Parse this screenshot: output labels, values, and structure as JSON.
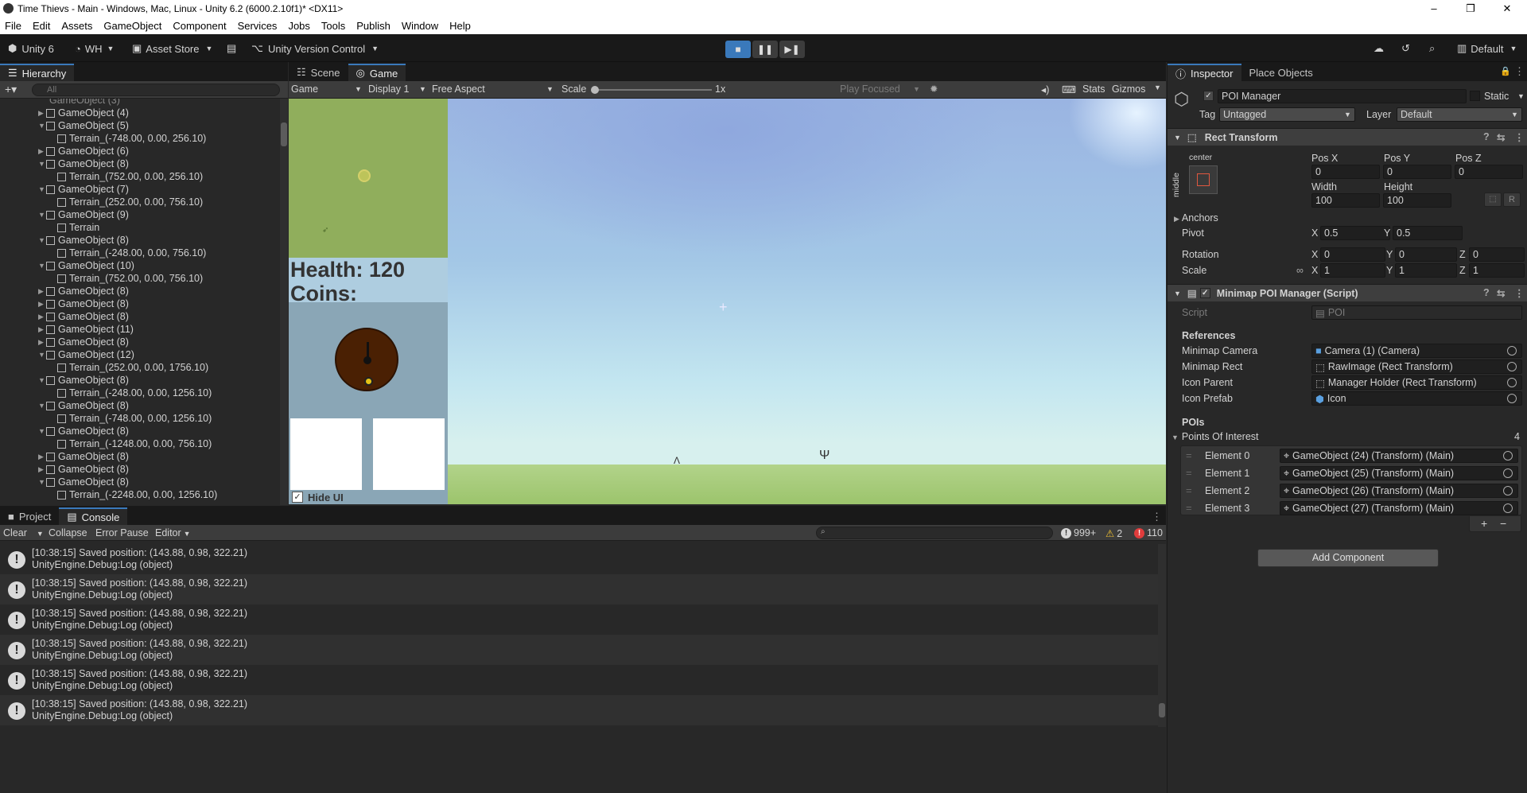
{
  "window": {
    "title": "Time Thievs - Main - Windows, Mac, Linux - Unity 6.2 (6000.2.10f1)* <DX11>"
  },
  "menu": [
    "File",
    "Edit",
    "Assets",
    "GameObject",
    "Component",
    "Services",
    "Jobs",
    "Tools",
    "Publish",
    "Window",
    "Help"
  ],
  "toolbar": {
    "unity": "Unity 6",
    "account": "WH",
    "asset_store": "Asset Store",
    "version_control": "Unity Version Control",
    "layout": "Default"
  },
  "hierarchy": {
    "tab": "Hierarchy",
    "search_placeholder": "All",
    "rows": [
      {
        "label": "GameObject (4)",
        "indent": 1,
        "open": false
      },
      {
        "label": "GameObject (5)",
        "indent": 1,
        "open": true
      },
      {
        "label": "Terrain_(-748.00, 0.00, 256.10)",
        "indent": 2,
        "open": null
      },
      {
        "label": "GameObject (6)",
        "indent": 1,
        "open": false
      },
      {
        "label": "GameObject (8)",
        "indent": 1,
        "open": true
      },
      {
        "label": "Terrain_(752.00, 0.00, 256.10)",
        "indent": 2,
        "open": null
      },
      {
        "label": "GameObject (7)",
        "indent": 1,
        "open": true
      },
      {
        "label": "Terrain_(252.00, 0.00, 756.10)",
        "indent": 2,
        "open": null
      },
      {
        "label": "GameObject (9)",
        "indent": 1,
        "open": true
      },
      {
        "label": "Terrain",
        "indent": 2,
        "open": null
      },
      {
        "label": "GameObject (8)",
        "indent": 1,
        "open": true
      },
      {
        "label": "Terrain_(-248.00, 0.00, 756.10)",
        "indent": 2,
        "open": null
      },
      {
        "label": "GameObject (10)",
        "indent": 1,
        "open": true
      },
      {
        "label": "Terrain_(752.00, 0.00, 756.10)",
        "indent": 2,
        "open": null
      },
      {
        "label": "GameObject (8)",
        "indent": 1,
        "open": false
      },
      {
        "label": "GameObject (8)",
        "indent": 1,
        "open": false
      },
      {
        "label": "GameObject (8)",
        "indent": 1,
        "open": false
      },
      {
        "label": "GameObject (11)",
        "indent": 1,
        "open": false
      },
      {
        "label": "GameObject (8)",
        "indent": 1,
        "open": false
      },
      {
        "label": "GameObject (12)",
        "indent": 1,
        "open": true
      },
      {
        "label": "Terrain_(252.00, 0.00, 1756.10)",
        "indent": 2,
        "open": null
      },
      {
        "label": "GameObject (8)",
        "indent": 1,
        "open": true
      },
      {
        "label": "Terrain_(-248.00, 0.00, 1256.10)",
        "indent": 2,
        "open": null
      },
      {
        "label": "GameObject (8)",
        "indent": 1,
        "open": true
      },
      {
        "label": "Terrain_(-748.00, 0.00, 1256.10)",
        "indent": 2,
        "open": null
      },
      {
        "label": "GameObject (8)",
        "indent": 1,
        "open": true
      },
      {
        "label": "Terrain_(-1248.00, 0.00, 756.10)",
        "indent": 2,
        "open": null
      },
      {
        "label": "GameObject (8)",
        "indent": 1,
        "open": false
      },
      {
        "label": "GameObject (8)",
        "indent": 1,
        "open": false
      },
      {
        "label": "GameObject (8)",
        "indent": 1,
        "open": true
      },
      {
        "label": "Terrain_(-2248.00, 0.00, 1256.10)",
        "indent": 2,
        "open": null
      }
    ]
  },
  "game": {
    "tabs": [
      "Scene",
      "Game"
    ],
    "view_mode": "Game",
    "display": "Display 1",
    "aspect": "Free Aspect",
    "scale_label": "Scale",
    "scale_value": "1x",
    "play_mode": "Play Focused",
    "stats": "Stats",
    "gizmos": "Gizmos",
    "health": "Health: 120",
    "coins": "Coins:",
    "hide_ui": "Hide UI"
  },
  "console": {
    "tabs": [
      "Project",
      "Console"
    ],
    "clear": "Clear",
    "collapse": "Collapse",
    "error_pause": "Error Pause",
    "editor": "Editor",
    "count_log": "999+",
    "count_warn": "2",
    "count_err": "110",
    "logs": [
      {
        "line1": "[10:38:15] Saved position: (143.88, 0.98, 322.21)",
        "line2": "UnityEngine.Debug:Log (object)"
      },
      {
        "line1": "[10:38:15] Saved position: (143.88, 0.98, 322.21)",
        "line2": "UnityEngine.Debug:Log (object)"
      },
      {
        "line1": "[10:38:15] Saved position: (143.88, 0.98, 322.21)",
        "line2": "UnityEngine.Debug:Log (object)"
      },
      {
        "line1": "[10:38:15] Saved position: (143.88, 0.98, 322.21)",
        "line2": "UnityEngine.Debug:Log (object)"
      },
      {
        "line1": "[10:38:15] Saved position: (143.88, 0.98, 322.21)",
        "line2": "UnityEngine.Debug:Log (object)"
      },
      {
        "line1": "[10:38:15] Saved position: (143.88, 0.98, 322.21)",
        "line2": "UnityEngine.Debug:Log (object)"
      }
    ]
  },
  "inspector": {
    "tabs": [
      "Inspector",
      "Place Objects"
    ],
    "object_name": "POI Manager",
    "static": "Static",
    "tag_label": "Tag",
    "tag": "Untagged",
    "layer_label": "Layer",
    "layer": "Default",
    "rect": {
      "title": "Rect Transform",
      "anchor_h": "center",
      "anchor_v": "middle",
      "posx_l": "Pos X",
      "posy_l": "Pos Y",
      "posz_l": "Pos Z",
      "posx": "0",
      "posy": "0",
      "posz": "0",
      "width_l": "Width",
      "height_l": "Height",
      "width": "100",
      "height": "100",
      "anchors": "Anchors",
      "pivot": "Pivot",
      "pivot_x": "0.5",
      "pivot_y": "0.5",
      "rotation": "Rotation",
      "rot_x": "0",
      "rot_y": "0",
      "rot_z": "0",
      "scale": "Scale",
      "scale_x": "1",
      "scale_y": "1",
      "scale_z": "1",
      "x": "X",
      "y": "Y",
      "z": "Z",
      "r": "R"
    },
    "script": {
      "title": "Minimap POI Manager (Script)",
      "script_l": "Script",
      "script_v": "POI",
      "references": "References",
      "cam_l": "Minimap Camera",
      "cam_v": "Camera (1) (Camera)",
      "rect_l": "Minimap Rect",
      "rect_v": "RawImage (Rect Transform)",
      "parent_l": "Icon Parent",
      "parent_v": "Manager Holder (Rect Transform)",
      "prefab_l": "Icon Prefab",
      "prefab_v": "Icon",
      "pois": "POIs",
      "poi_list": "Points Of Interest",
      "poi_count": "4",
      "elements": [
        {
          "label": "Element 0",
          "value": "GameObject (24) (Transform) (Main)"
        },
        {
          "label": "Element 1",
          "value": "GameObject (25) (Transform) (Main)"
        },
        {
          "label": "Element 2",
          "value": "GameObject (26) (Transform) (Main)"
        },
        {
          "label": "Element 3",
          "value": "GameObject (27) (Transform) (Main)"
        }
      ]
    },
    "add_component": "Add Component"
  },
  "colors": {
    "accent": "#3a79bb",
    "panel": "#282828",
    "dark": "#191919"
  }
}
